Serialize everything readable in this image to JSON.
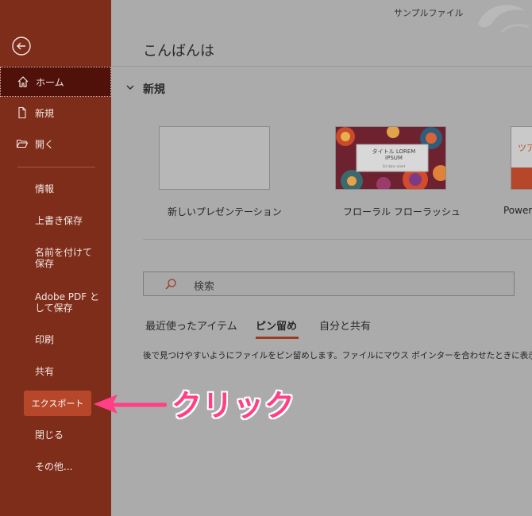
{
  "app": {
    "file_title": "サンプルファイル"
  },
  "sidebar": {
    "home": "ホーム",
    "new": "新規",
    "open": "開く",
    "items": [
      "情報",
      "上書き保存",
      "名前を付けて保存",
      "Adobe PDF として保存",
      "印刷",
      "共有",
      "エクスポート",
      "閉じる",
      "その他..."
    ]
  },
  "main": {
    "greeting": "こんばんは",
    "section_title": "新規",
    "templates": [
      {
        "label": "新しいプレゼンテーション"
      },
      {
        "label": "フローラル フローラッシュ",
        "thumb_title": "タイトル LOREM IPSUM",
        "thumb_sub": "Sit dolor amet"
      },
      {
        "label": "Power",
        "thumb_title": "ツア"
      }
    ],
    "search_placeholder": "検索",
    "tabs": [
      "最近使ったアイテム",
      "ピン留め",
      "自分と共有"
    ],
    "description": "後で見つけやすいようにファイルをピン留めします。ファイルにマウス ポインターを合わせたときに表示されるピン"
  },
  "annotation": {
    "text": "クリック",
    "color": "#ff3f86"
  },
  "colors": {
    "sidebar": "#7e2d1b",
    "sidebar_active": "#4f1109",
    "accent": "#b7472a"
  }
}
